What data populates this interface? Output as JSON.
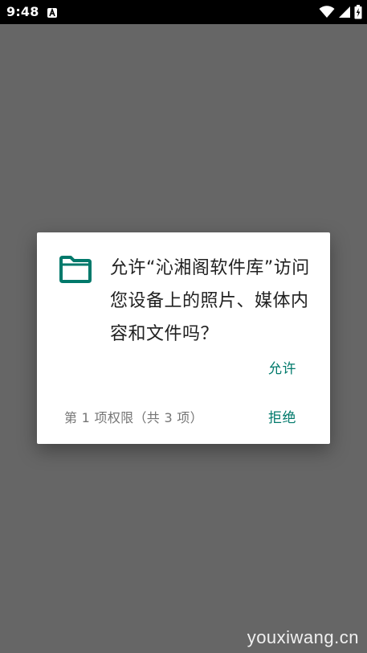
{
  "status_bar": {
    "time": "9:48",
    "icons": [
      "android-notification-icon",
      "wifi-icon",
      "signal-icon",
      "battery-charging-icon"
    ]
  },
  "dialog": {
    "icon": "folder-icon",
    "message": "允许“沁湘阁软件库”访问您设备上的照片、媒体内容和文件吗？",
    "allow_label": "允许",
    "deny_label": "拒绝",
    "permission_counter": "第 1 项权限（共 3 项）"
  },
  "watermark": "youxiwang.cn",
  "colors": {
    "accent": "#00796b",
    "scrim": "#666666",
    "status_bar": "#000000"
  }
}
